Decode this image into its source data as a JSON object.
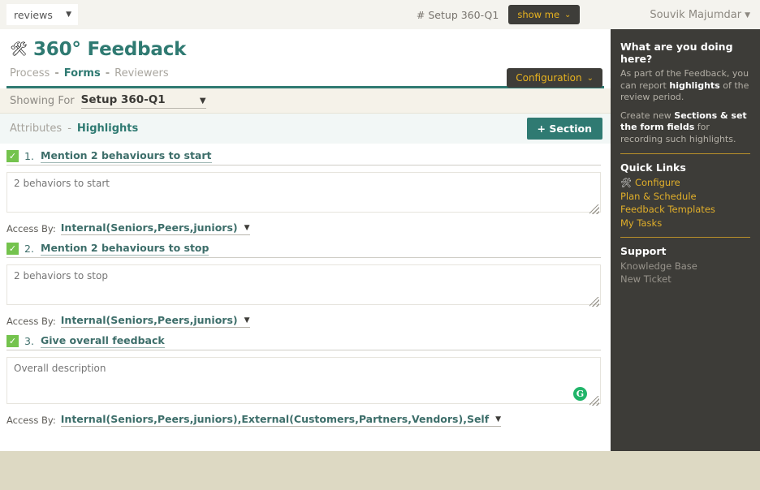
{
  "topbar": {
    "context_select": {
      "value": "reviews",
      "caret": "▼"
    },
    "setup_label": "# Setup 360-Q1",
    "show_me": {
      "label": "show me",
      "chevron": "⌄"
    },
    "user": {
      "name": "Souvik Majumdar",
      "caret": "▼"
    }
  },
  "page": {
    "icon": "🛠",
    "title": "360° Feedback",
    "breadcrumbs": [
      {
        "label": "Process",
        "active": false
      },
      {
        "label": "Forms",
        "active": true
      },
      {
        "label": "Reviewers",
        "active": false
      }
    ],
    "breadcrumb_separator": "-",
    "configuration_button": {
      "label": "Configuration",
      "chevron": "⌄"
    }
  },
  "showing": {
    "label": "Showing For",
    "value": "Setup 360-Q1",
    "caret": "▼"
  },
  "tabs": {
    "items": [
      {
        "label": "Attributes",
        "active": false
      },
      {
        "label": "Highlights",
        "active": true
      }
    ],
    "separator": "-",
    "add_section_button": "+ Section"
  },
  "form_items": [
    {
      "checked": true,
      "check_glyph": "✓",
      "number": "1.",
      "title": "Mention 2 behaviours to start",
      "placeholder": "2 behaviors to start",
      "access_label": "Access By:",
      "access_value": "Internal(Seniors,Peers,juniors)",
      "access_caret": "▼",
      "has_grammarly": false
    },
    {
      "checked": true,
      "check_glyph": "✓",
      "number": "2.",
      "title": "Mention 2 behaviours to stop",
      "placeholder": "2 behaviors to stop",
      "access_label": "Access By:",
      "access_value": "Internal(Seniors,Peers,juniors)",
      "access_caret": "▼",
      "has_grammarly": false
    },
    {
      "checked": true,
      "check_glyph": "✓",
      "number": "3.",
      "title": "Give overall feedback",
      "placeholder": "Overall description",
      "access_label": "Access By:",
      "access_value": "Internal(Seniors,Peers,juniors),External(Customers,Partners,Vendors),Self",
      "access_caret": "▼",
      "has_grammarly": true,
      "grammarly_glyph": "G"
    }
  ],
  "sidebar": {
    "help_title": "What are you doing here?",
    "help_p1_a": "As part of the Feedback, you can report ",
    "help_p1_b": "highlights",
    "help_p1_c": " of the review period.",
    "help_p2_a": "Create new ",
    "help_p2_b": "Sections & set the form fields",
    "help_p2_c": " for recording such highlights.",
    "quick_links_title": "Quick Links",
    "quick_links": [
      {
        "label": "Configure",
        "icon": "🛠"
      },
      {
        "label": "Plan & Schedule",
        "icon": ""
      },
      {
        "label": "Feedback Templates",
        "icon": ""
      },
      {
        "label": "My Tasks",
        "icon": ""
      }
    ],
    "support_title": "Support",
    "support_links": [
      {
        "label": "Knowledge Base"
      },
      {
        "label": "New Ticket"
      }
    ]
  },
  "colors": {
    "teal": "#2f7a72",
    "gold": "#e0ae2a",
    "dark": "#3d3c38",
    "green_check": "#74c34d",
    "page_beige": "#ddd9c3"
  }
}
